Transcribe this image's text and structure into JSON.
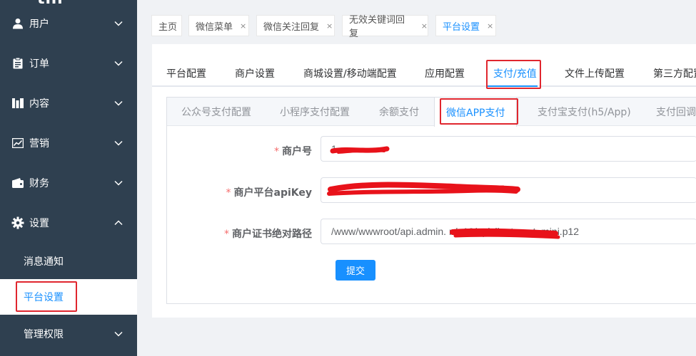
{
  "sidebar": {
    "logo_fragment": "thi",
    "menu": [
      {
        "label": "用户",
        "icon": "user-icon",
        "expanded": false
      },
      {
        "label": "订单",
        "icon": "order-icon",
        "expanded": false
      },
      {
        "label": "内容",
        "icon": "content-icon",
        "expanded": false
      },
      {
        "label": "营销",
        "icon": "marketing-icon",
        "expanded": false
      },
      {
        "label": "财务",
        "icon": "wallet-icon",
        "expanded": false
      },
      {
        "label": "设置",
        "icon": "gear-icon",
        "expanded": true
      }
    ],
    "settings_children": [
      {
        "label": "消息通知",
        "active": false
      },
      {
        "label": "平台设置",
        "active": true
      },
      {
        "label": "管理权限",
        "active": false
      }
    ]
  },
  "tags": [
    {
      "label": "主页",
      "closable": false
    },
    {
      "label": "微信菜单",
      "closable": true
    },
    {
      "label": "微信关注回复",
      "closable": true
    },
    {
      "label": "无效关键词回复",
      "closable": true
    },
    {
      "label": "平台设置",
      "closable": true,
      "active": true
    }
  ],
  "tag_close_glyph": "×",
  "top_tabs": [
    "平台配置",
    "商户设置",
    "商城设置/移动端配置",
    "应用配置",
    "支付/充值",
    "文件上传配置",
    "第三方配置"
  ],
  "top_tabs_active": "支付/充值",
  "sub_tabs": [
    "公众号支付配置",
    "小程序支付配置",
    "余额支付",
    "微信APP支付",
    "支付宝支付(h5/App)",
    "支付回调"
  ],
  "sub_tabs_active": "微信APP支付",
  "form": {
    "required_mark": "*",
    "fields": [
      {
        "label": "商户号",
        "value": "1"
      },
      {
        "label": "商户平台apiKey",
        "value": ""
      },
      {
        "label": "商户证书绝对路径",
        "value": "/www/wwwroot/api.admin.                          n/p12/apiclient_cert_mini.p12"
      }
    ],
    "submit_label": "提交"
  },
  "colors": {
    "sidebar_bg": "#2f4050",
    "accent": "#1890ff",
    "highlight_box": "#e0262e",
    "redaction": "#e8121a"
  }
}
